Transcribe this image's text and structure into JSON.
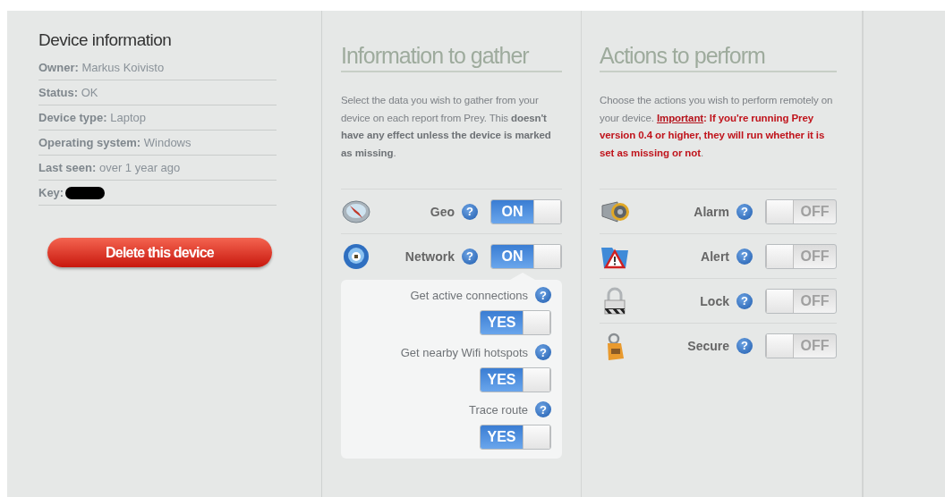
{
  "device_info": {
    "title": "Device information",
    "fields": [
      {
        "label": "Owner:",
        "value": "Markus Koivisto"
      },
      {
        "label": "Status:",
        "value": "OK"
      },
      {
        "label": "Device type:",
        "value": "Laptop"
      },
      {
        "label": "Operating system:",
        "value": "Windows"
      },
      {
        "label": "Last seen:",
        "value": "over 1 year ago"
      },
      {
        "label": "Key:",
        "value_redacted": true
      }
    ],
    "delete_button": "Delete this device"
  },
  "gather": {
    "title": "Information to gather",
    "description": "Select the data you wish to gather from your device on each report from Prey. This **doesn't have any effect unless the device is marked as missing**.",
    "items": [
      {
        "kind": "compass",
        "label": "Geo",
        "help": "?",
        "toggle": "ON",
        "on": true
      },
      {
        "kind": "network",
        "label": "Network",
        "help": "?",
        "toggle": "ON",
        "on": true,
        "expanded": true,
        "options": [
          {
            "label": "Get active connections",
            "help": "?",
            "toggle": "YES",
            "on": true
          },
          {
            "label": "Get nearby Wifi hotspots",
            "help": "?",
            "toggle": "YES",
            "on": true
          },
          {
            "label": "Trace route",
            "help": "?",
            "toggle": "YES",
            "on": true
          }
        ]
      }
    ]
  },
  "actions": {
    "title": "Actions to perform",
    "description": [
      {
        "kind": "plain",
        "text": "Choose the actions you wish to perform remotely on your device. "
      },
      {
        "kind": "link",
        "text": "Important"
      },
      {
        "kind": "warning",
        "text": ": If you're running Prey version 0.4 or higher, they will run whether it is set as missing or not"
      },
      {
        "kind": "plain",
        "text": "."
      }
    ],
    "items": [
      {
        "kind": "megaphone",
        "label": "Alarm",
        "help": "?",
        "toggle": "OFF",
        "on": false
      },
      {
        "kind": "warning-folder",
        "label": "Alert",
        "help": "?",
        "toggle": "OFF",
        "on": false
      },
      {
        "kind": "padlock",
        "label": "Lock",
        "help": "?",
        "toggle": "OFF",
        "on": false
      },
      {
        "kind": "tag",
        "label": "Secure",
        "help": "?",
        "toggle": "OFF",
        "on": false
      }
    ]
  }
}
